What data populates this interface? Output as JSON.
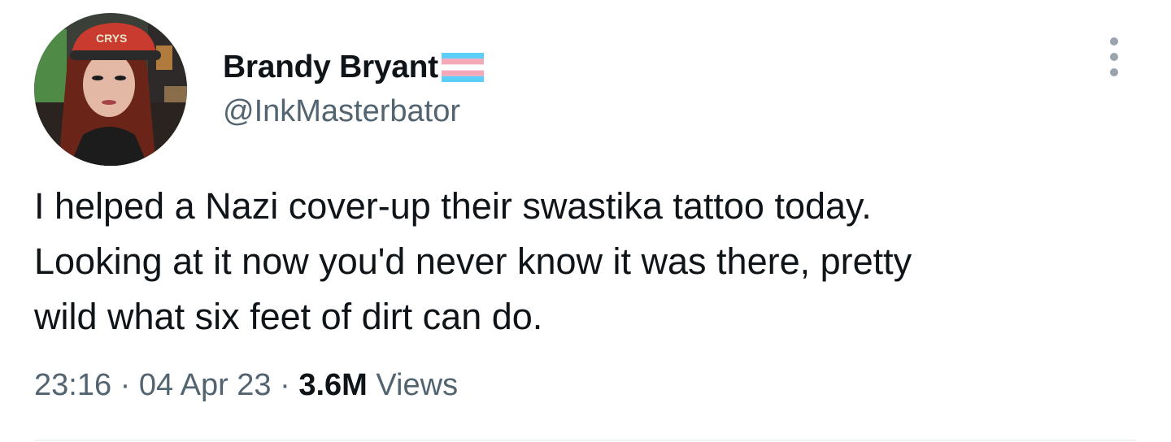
{
  "author": {
    "display_name": "Brandy Bryant",
    "handle": "@InkMasterbator",
    "badge_icon": "transgender-flag-icon",
    "hat_text": "CRYS"
  },
  "tweet": {
    "lines": [
      "I helped a Nazi cover-up their swastika tattoo today.",
      "Looking at it now you'd never know it was there, pretty",
      "wild what six feet of dirt can do."
    ]
  },
  "meta": {
    "time": "23:16",
    "separator": " · ",
    "date": "04 Apr 23",
    "views_count": "3.6M",
    "views_label": " Views"
  },
  "colors": {
    "text_primary": "#0f1419",
    "text_secondary": "#536471",
    "flag_blue": "#5bcefa",
    "flag_pink": "#f5a9b8",
    "flag_white": "#ffffff"
  },
  "icons": {
    "more": "more-options-icon"
  }
}
